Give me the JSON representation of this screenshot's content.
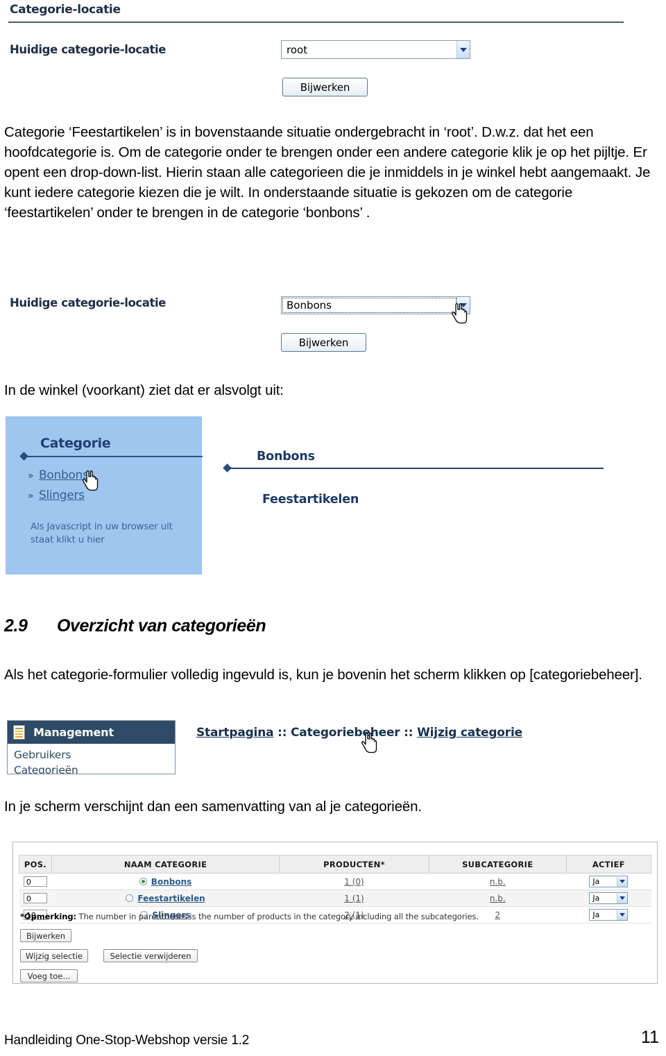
{
  "screenshot_form_top": {
    "title": "Categorie-locatie",
    "field_label": "Huidige categorie-locatie",
    "select_value": "root",
    "update_button": "Bijwerken"
  },
  "paragraph_1": "Categorie ‘Feestartikelen’ is in bovenstaande situatie ondergebracht in ‘root’. D.w.z. dat het een hoofdcategorie is. Om de categorie onder te brengen onder een andere categorie klik je op het pijltje. Er opent een drop-down-list. Hierin staan alle categorieen die je inmiddels in je winkel hebt aangemaakt. Je kunt iedere categorie kiezen die je wilt. In onderstaande situatie is gekozen om de categorie ‘feestartikelen’ onder te brengen in de categorie ‘bonbons’ .",
  "screenshot_form_bonbons": {
    "field_label": "Huidige categorie-locatie",
    "select_value": "Bonbons",
    "update_button": "Bijwerken"
  },
  "paragraph_2": "In de winkel (voorkant) ziet dat er alsvolgt uit:",
  "shop_preview": {
    "sidebar": {
      "title": "Categorie",
      "links": [
        "Bonbons",
        "Slingers"
      ],
      "note": "Als Javascript in uw browser uit staat klikt u hier"
    },
    "main": {
      "heading": "Bonbons",
      "subheading": "Feestartikelen"
    }
  },
  "section": {
    "number": "2.9",
    "title": "Overzicht van categorieën"
  },
  "paragraph_3": "Als het categorie-formulier volledig ingevuld is, kun je bovenin het scherm klikken op [categoriebeheer].",
  "screenshot_management": {
    "panel_title": "Management",
    "panel_items": [
      "Gebruikers",
      "Categorieën"
    ],
    "breadcrumb": {
      "item1": "Startpagina",
      "sep1": " :: ",
      "item2": "Categoriebeheer",
      "sep2": " :: ",
      "item3": "Wijzig categorie"
    }
  },
  "paragraph_4": "In je scherm verschijnt dan een samenvatting van al je categorieën.",
  "screenshot_overview_table": {
    "headers": [
      "POS.",
      "NAAM CATEGORIE",
      "PRODUCTEN*",
      "SUBCATEGORIE",
      "ACTIEF"
    ],
    "rows": [
      {
        "pos": "0",
        "selected": true,
        "name": "Bonbons",
        "producten": "1 (0)",
        "subcategorie": "n.b.",
        "actief": "Ja"
      },
      {
        "pos": "0",
        "selected": false,
        "name": "Feestartikelen",
        "producten": "1 (1)",
        "subcategorie": "n.b.",
        "actief": "Ja"
      },
      {
        "pos": "10",
        "selected": false,
        "name": "Slingers",
        "producten": "2 (1)",
        "subcategorie": "2",
        "actief": "Ja"
      }
    ],
    "footnote_label": "*Opmerking:",
    "footnote_text": " The number in parentheses is the number of products in the category including all the subcategories.",
    "buttons": {
      "update": "Bijwerken",
      "edit_selection": "Wijzig selectie",
      "delete_selection": "Selectie verwijderen",
      "add": "Voeg toe..."
    }
  },
  "footer": {
    "text": "Handleiding One-Stop-Webshop versie 1.2",
    "page_number": "11"
  }
}
